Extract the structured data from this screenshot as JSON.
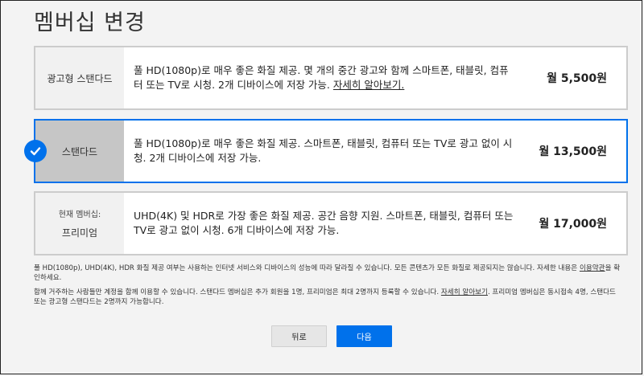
{
  "page": {
    "title": "멤버십 변경"
  },
  "plans": [
    {
      "current_label": "",
      "name": "광고형 스탠다드",
      "desc": "풀 HD(1080p)로 매우 좋은 화질 제공. 몇 개의 중간 광고와 함께 스마트폰, 태블릿, 컴퓨터 또는 TV로 시청. 2개 디바이스에 저장 가능.",
      "link": "자세히 알아보기.",
      "price": "월 5,500원",
      "selected": false
    },
    {
      "current_label": "",
      "name": "스탠다드",
      "desc": "풀 HD(1080p)로 매우 좋은 화질 제공. 스마트폰, 태블릿, 컴퓨터 또는 TV로 광고 없이 시청. 2개 디바이스에 저장 가능.",
      "link": "",
      "price": "월 13,500원",
      "selected": true
    },
    {
      "current_label": "현재 멤버십:",
      "name": "프리미엄",
      "desc": "UHD(4K) 및 HDR로 가장 좋은 화질 제공. 공간 음향 지원. 스마트폰, 태블릿, 컴퓨터 또는 TV로 광고 없이 시청. 6개 디바이스에 저장 가능.",
      "link": "",
      "price": "월 17,000원",
      "selected": false
    }
  ],
  "notes": {
    "note1_text": "풀 HD(1080p), UHD(4K), HDR 화질 제공 여부는 사용하는 인터넷 서비스와 디바이스의 성능에 따라 달라질 수 있습니다. 모든 콘텐츠가 모든 화질로 제공되지는 않습니다. 자세한 내용은 ",
    "note1_link": "이용약관",
    "note1_tail": "을 확인하세요.",
    "note2_text": "함께 거주하는 사람들만 계정을 함께 이용할 수 있습니다. 스탠다드 멤버십은 추가 회원을 1명, 프리미엄은 최대 2명까지 등록할 수 있습니다. ",
    "note2_link": "자세히 알아보기",
    "note2_tail": ". 프리미엄 멤버십은 동시접속 4명, 스탠다드 또는 광고형 스탠다드는 2명까지 가능합니다."
  },
  "buttons": {
    "back": "뒤로",
    "next": "다음"
  },
  "colors": {
    "accent": "#0071eb",
    "selected_name_bg": "#c6c6c6"
  }
}
